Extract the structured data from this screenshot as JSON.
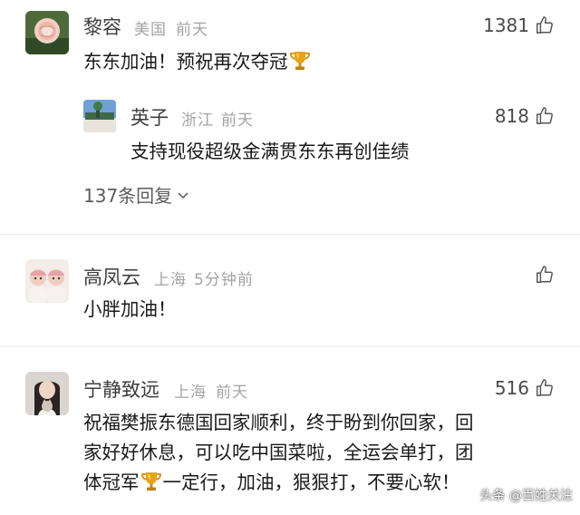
{
  "comments": [
    {
      "user": "黎容",
      "location": "美国",
      "time": "前天",
      "likes": "1381",
      "text": "东东加油！预祝再次夺冠",
      "reply": {
        "user": "英子",
        "location": "浙江",
        "time": "前天",
        "likes": "818",
        "text": "支持现役超级金满贯东东再创佳绩"
      },
      "reply_count": "137条回复"
    },
    {
      "user": "高凤云",
      "location": "上海",
      "time": "5分钟前",
      "text": "小胖加油！"
    },
    {
      "user": "宁静致远",
      "location": "上海",
      "time": "前天",
      "likes": "516",
      "lines": [
        "祝福樊振东德国回家顺利，终于盼到你回家，回",
        "家好好休息，可以吃中国菜啦，全运会单打，团",
        "体冠军",
        "一定行，加油，狠狠打，不要心软！"
      ]
    }
  ],
  "watermark": "头条 @百姓关注",
  "colors": {
    "meta": "#a3a3a3",
    "name": "#3d3d3d",
    "divider": "#ececec"
  },
  "icons": [
    "thumbs-up-icon",
    "trophy-icon",
    "chevron-down-icon"
  ]
}
